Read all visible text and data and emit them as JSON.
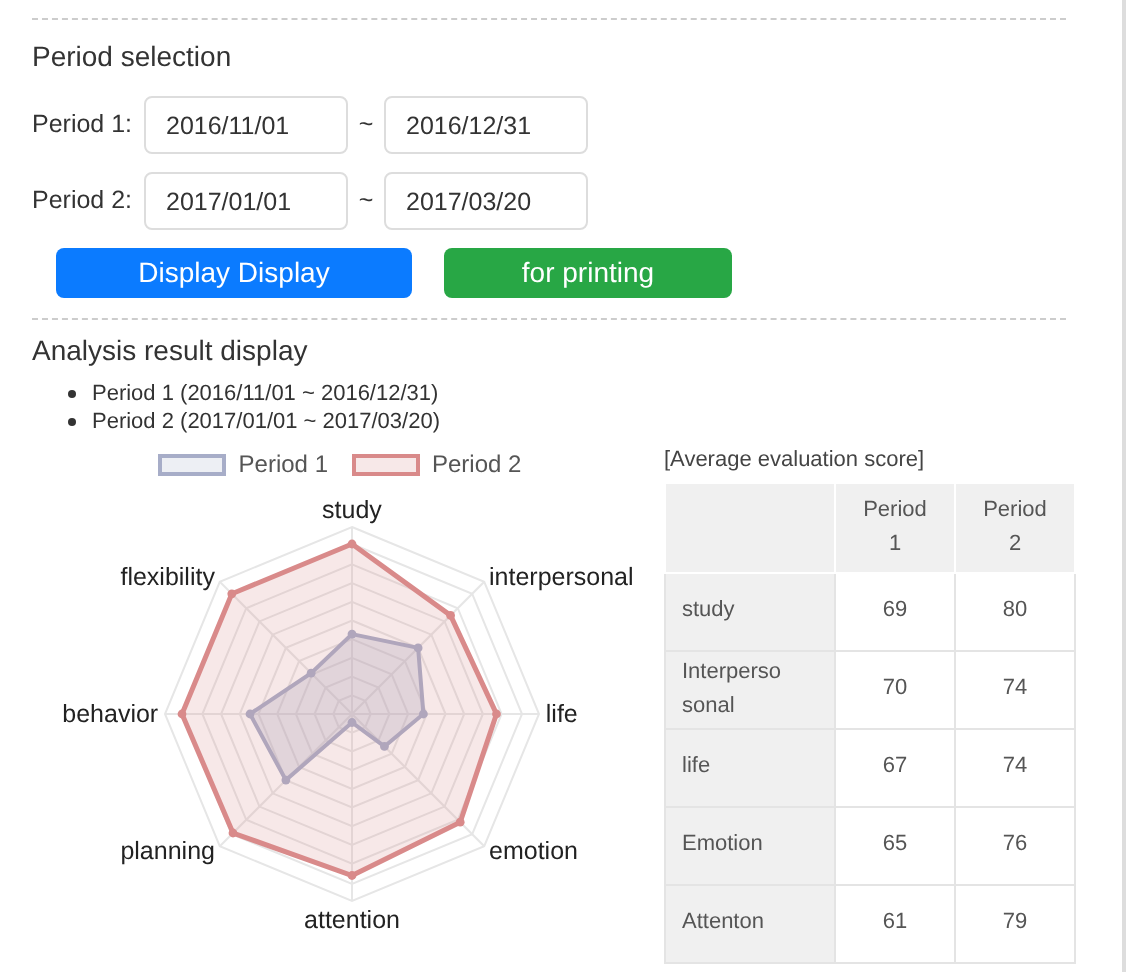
{
  "period_selection": {
    "title": "Period selection",
    "periods": [
      {
        "label": "Period 1:",
        "from": "2016/11/01",
        "separator": "~",
        "to": "2016/12/31"
      },
      {
        "label": "Period 2:",
        "from": "2017/01/01",
        "separator": "~",
        "to": "2017/03/20"
      }
    ],
    "buttons": [
      {
        "label": "Display Display",
        "kind": "primary"
      },
      {
        "label": "for printing",
        "kind": "success"
      }
    ]
  },
  "analysis": {
    "title": "Analysis result display",
    "period_list": [
      "Period 1 (2016/11/01 ~ 2016/12/31)",
      "Period 2 (2017/01/01 ~ 2017/03/20)"
    ],
    "radar": {
      "legend": [
        {
          "name": "Period 1",
          "color": "#a7adc8"
        },
        {
          "name": "Period 2",
          "color": "#d98a8a"
        }
      ],
      "axes": [
        "study",
        "interpersonal",
        "life",
        "emotion",
        "attention",
        "planning",
        "behavior",
        "flexibility"
      ]
    },
    "table": {
      "caption": "[Average evaluation score]",
      "columns": [
        "",
        "Period 1",
        "Period 2"
      ],
      "rows": [
        [
          "study",
          "69",
          "80"
        ],
        [
          "Interperso sonal",
          "70",
          "74"
        ],
        [
          "life",
          "67",
          "74"
        ],
        [
          "Emotion",
          "65",
          "76"
        ],
        [
          "Attenton",
          "61",
          "79"
        ]
      ]
    }
  }
}
